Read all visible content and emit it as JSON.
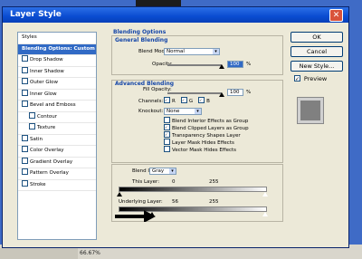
{
  "dialog": {
    "title": "Layer Style"
  },
  "styles_list": {
    "header": "Styles",
    "items": [
      {
        "label": "Blending Options: Custom",
        "selected": true,
        "checkbox": false,
        "indent": false
      },
      {
        "label": "Drop Shadow",
        "selected": false,
        "checkbox": true,
        "indent": false
      },
      {
        "label": "Inner Shadow",
        "selected": false,
        "checkbox": true,
        "indent": false
      },
      {
        "label": "Outer Glow",
        "selected": false,
        "checkbox": true,
        "indent": false
      },
      {
        "label": "Inner Glow",
        "selected": false,
        "checkbox": true,
        "indent": false
      },
      {
        "label": "Bevel and Emboss",
        "selected": false,
        "checkbox": true,
        "indent": false
      },
      {
        "label": "Contour",
        "selected": false,
        "checkbox": true,
        "indent": true
      },
      {
        "label": "Texture",
        "selected": false,
        "checkbox": true,
        "indent": true
      },
      {
        "label": "Satin",
        "selected": false,
        "checkbox": true,
        "indent": false
      },
      {
        "label": "Color Overlay",
        "selected": false,
        "checkbox": true,
        "indent": false
      },
      {
        "label": "Gradient Overlay",
        "selected": false,
        "checkbox": true,
        "indent": false
      },
      {
        "label": "Pattern Overlay",
        "selected": false,
        "checkbox": true,
        "indent": false
      },
      {
        "label": "Stroke",
        "selected": false,
        "checkbox": true,
        "indent": false
      }
    ]
  },
  "blending_options": {
    "section_title": "Blending Options",
    "general": {
      "title": "General Blending",
      "blend_mode_label": "Blend Mode:",
      "blend_mode_value": "Normal",
      "opacity_label": "Opacity:",
      "opacity_value": "100",
      "opacity_unit": "%"
    },
    "advanced": {
      "title": "Advanced Blending",
      "fill_opacity_label": "Fill Opacity:",
      "fill_opacity_value": "100",
      "fill_opacity_unit": "%",
      "channels_label": "Channels:",
      "channels": [
        "R",
        "G",
        "B"
      ],
      "knockout_label": "Knockout:",
      "knockout_value": "None",
      "options": [
        {
          "label": "Blend Interior Effects as Group",
          "checked": false
        },
        {
          "label": "Blend Clipped Layers as Group",
          "checked": true
        },
        {
          "label": "Transparency Shapes Layer",
          "checked": true
        },
        {
          "label": "Layer Mask Hides Effects",
          "checked": false
        },
        {
          "label": "Vector Mask Hides Effects",
          "checked": false
        }
      ]
    },
    "blend_if": {
      "label": "Blend If:",
      "value": "Gray",
      "this_layer_label": "This Layer:",
      "this_layer_low": "0",
      "this_layer_high": "255",
      "underlying_label": "Underlying Layer:",
      "underlying_low": "56",
      "underlying_high": "255"
    }
  },
  "buttons": {
    "ok": "OK",
    "cancel": "Cancel",
    "new_style": "New Style...",
    "preview": "Preview"
  },
  "status": {
    "zoom": "66.67%"
  }
}
